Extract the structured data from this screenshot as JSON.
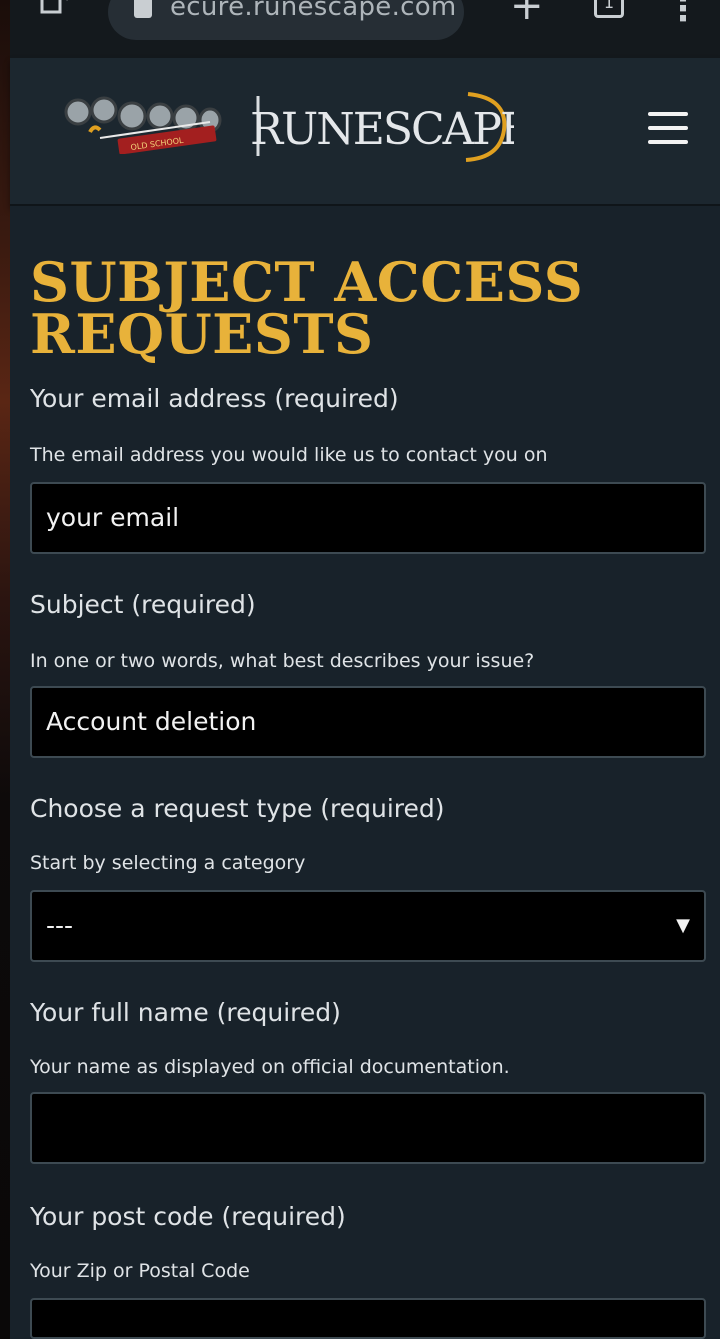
{
  "browser": {
    "url": "ecure.runescape.com",
    "tab_count": "1"
  },
  "header": {
    "osrs_logo_text": "OLD SCHOOL",
    "runescape_logo_text": "RUNESCAPE"
  },
  "page": {
    "title": "SUBJECT ACCESS REQUESTS"
  },
  "form": {
    "email": {
      "label": "Your email address (required)",
      "help": "The email address you would like us to contact you on",
      "value": "your email"
    },
    "subject": {
      "label": "Subject (required)",
      "help": "In one or two words, what best describes your issue?",
      "value": "Account deletion"
    },
    "request_type": {
      "label": "Choose a request type (required)",
      "help": "Start by selecting a category",
      "selected": "---"
    },
    "full_name": {
      "label": "Your full name (required)",
      "help": "Your name as displayed on official documentation.",
      "value": ""
    },
    "post_code": {
      "label": "Your post code (required)",
      "help": "Your Zip or Postal Code",
      "value": ""
    }
  },
  "colors": {
    "title_gold": "#e8b23a",
    "background": "#18222a",
    "input_background": "#000000"
  }
}
